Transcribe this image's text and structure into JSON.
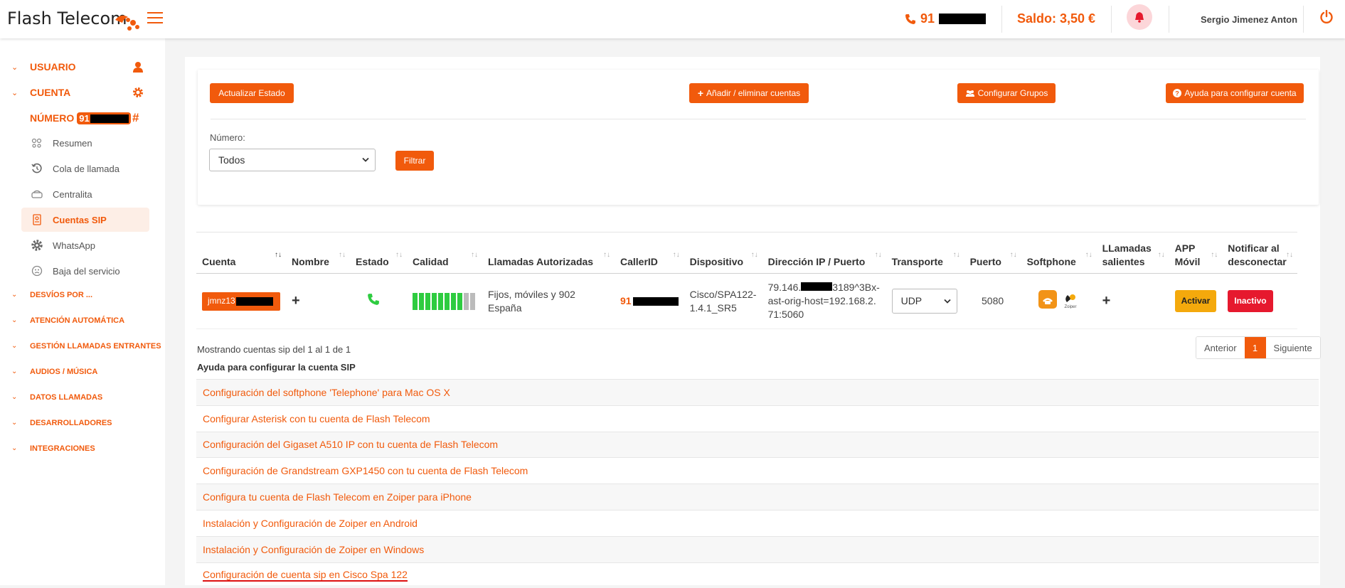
{
  "header": {
    "logo_text": "Flash Telecom",
    "phone_prefix": "91",
    "saldo": "Saldo: 3,50 €",
    "user": "Sergio Jimenez Anton"
  },
  "sidebar": {
    "usuario": "USUARIO",
    "cuenta": "CUENTA",
    "numero_label": "NÚMERO",
    "numero_prefix": "91",
    "subitems": [
      {
        "label": "Resumen",
        "icon": "gauge-icon"
      },
      {
        "label": "Cola de llamada",
        "icon": "history-icon"
      },
      {
        "label": "Centralita",
        "icon": "switchboard-icon"
      },
      {
        "label": "Cuentas SIP",
        "icon": "sip-account-icon"
      },
      {
        "label": "WhatsApp",
        "icon": "gear-icon"
      },
      {
        "label": "Baja del servicio",
        "icon": "cancel-service-icon"
      }
    ],
    "sections": [
      "DESVÍOS POR ...",
      "ATENCIÓN AUTOMÁTICA",
      "GESTIÓN LLAMADAS ENTRANTES",
      "AUDIOS / MÚSICA",
      "DATOS LLAMADAS",
      "DESARROLLADORES",
      "INTEGRACIONES"
    ]
  },
  "toolbar": {
    "actualizar": "Actualizar Estado",
    "anadir": "Añadir / eliminar cuentas",
    "grupos": "Configurar Grupos",
    "ayuda": "Ayuda para configurar cuenta",
    "numero_label": "Número:",
    "numero_value": "Todos",
    "filtrar": "Filtrar"
  },
  "table": {
    "headers": [
      "Cuenta",
      "Nombre",
      "Estado",
      "Calidad",
      "Llamadas Autorizadas",
      "CallerID",
      "Dispositivo",
      "Dirección IP / Puerto",
      "Transporte",
      "Puerto",
      "Softphone",
      "LLamadas salientes",
      "APP Móvil",
      "Notificar al desconectar"
    ],
    "row": {
      "cuenta": "jmnz13",
      "nombre": "+",
      "calidad": 0.8,
      "llamadas": "Fijos, móviles y 902 España",
      "callerid_prefix": "91",
      "dispositivo": "Cisco/SPA122-1.4.1_SR5",
      "ip_prefix": "79.146.",
      "ip_rest": "3189^3Bx-ast-orig-host=192.168.2.71:5060",
      "transporte": "UDP",
      "puerto": "5080",
      "salientes": "+",
      "app": "Activar",
      "notificar": "Inactivo"
    }
  },
  "footer": {
    "showing": "Mostrando cuentas sip del 1 al 1 de 1",
    "anterior": "Anterior",
    "page": "1",
    "siguiente": "Siguiente"
  },
  "help": {
    "title": "Ayuda para configurar la cuenta SIP",
    "items": [
      "Configuración del softphone 'Telephone' para Mac OS X",
      "Configurar Asterisk con tu cuenta de Flash Telecom",
      "Configuración del Gigaset A510 IP con tu cuenta de Flash Telecom",
      "Configuración de Grandstream GXP1450 con tu cuenta de Flash Telecom",
      "Configura tu cuenta de Flash Telecom en Zoiper para iPhone",
      "Instalación y Configuración de Zoiper en Android",
      "Instalación y Configuración de Zoiper en Windows",
      "Configuración de cuenta sip en Cisco Spa 122"
    ]
  },
  "colors": {
    "accent": "#f15a0c",
    "success": "#2ecc40",
    "warning": "#f4a90c",
    "danger": "#e6192e"
  }
}
